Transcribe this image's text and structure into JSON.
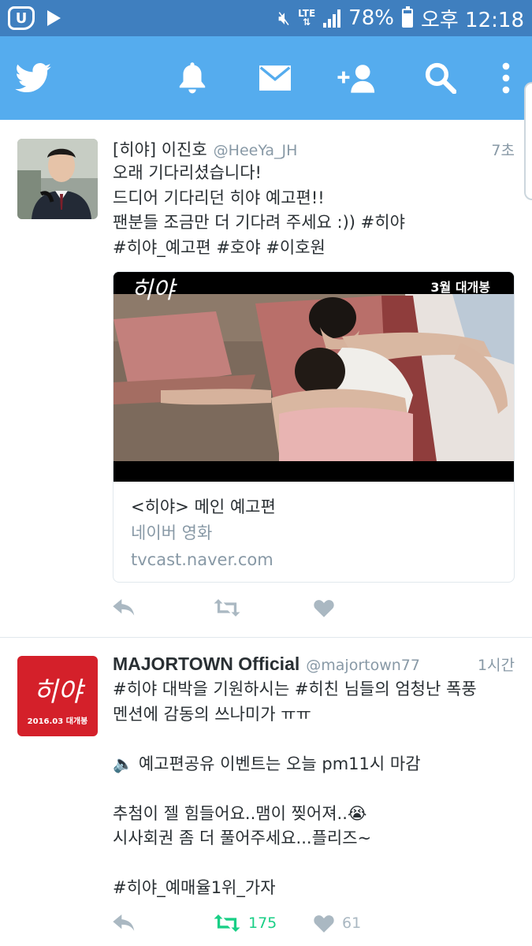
{
  "status_bar": {
    "battery": "78%",
    "time": "오후 12:18",
    "network": "LTE"
  },
  "colors": {
    "status_bar": "#3f7fbf",
    "app_bar": "#55acee",
    "retweet_active": "#19cf86",
    "muted": "#8899a6"
  },
  "app_bar": {
    "icons": [
      "twitter-bird-icon",
      "bell-icon",
      "envelope-icon",
      "add-user-icon",
      "search-icon",
      "more-icon"
    ]
  },
  "tweets": [
    {
      "name": "[히야] 이진호",
      "handle": "@HeeYa_JH",
      "time": "7초",
      "text": "오래 기다리셨습니다!\n드디어 기다리던 히야 예고편!!\n팬분들 조금만 더 기다려 주세요 :)) #히야\n#히야_예고편 #호야 #이호원",
      "card": {
        "overlay_title": "히야",
        "overlay_badge": "3월 대개봉",
        "title": "<히야> 메인 예고편",
        "source": "네이버 영화",
        "domain": "tvcast.naver.com"
      }
    },
    {
      "name": "MAJORTOWN Official",
      "handle": "@majortown77",
      "time": "1시간",
      "avatar_logo": "히야",
      "avatar_sub": "2016.03 대개봉",
      "text": "#히야 대박을 기원하시는 #히친 님들의 엄청난 폭풍\n멘션에 감동의 쓰나미가 ㅠㅠ\n\n🔈 예고편공유 이벤트는 오늘 pm11시 마감\n\n추첨이 젤 힘들어요..맴이 찢어져..😭\n시사회권 좀 더 풀어주세요...플리즈~\n\n#히야_예매율1위_가자",
      "retweets": "175",
      "likes": "61"
    }
  ]
}
